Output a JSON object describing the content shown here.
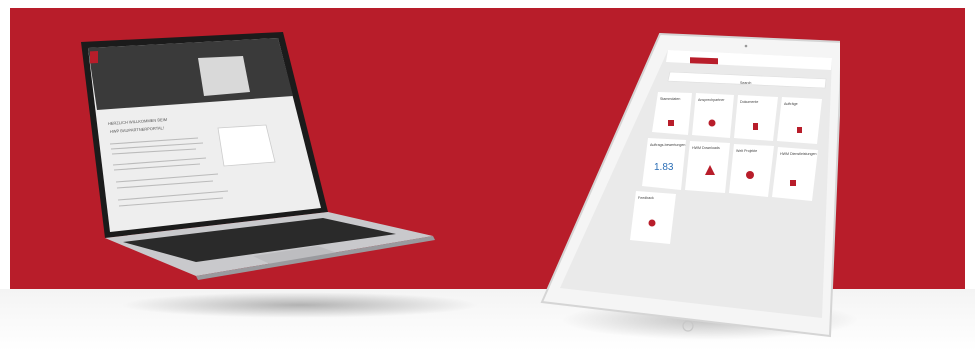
{
  "colors": {
    "brand_red": "#b81d2a",
    "screen_gray": "#3a3a3a",
    "tile_white": "#ffffff"
  },
  "laptop": {
    "screen_headline_1": "HERZLICH WILLKOMMEN BEIM",
    "screen_headline_2": "HWP BAUPARTNERPORTAL!"
  },
  "tablet": {
    "search_placeholder": "Search",
    "tiles": [
      "Stammdaten",
      "Ansprechpartner",
      "Dokumente",
      "Aufträge",
      "Auftrags-bewertungen",
      "HWM Downloads",
      "Welt Projekte",
      "HWM Dienstleistungen",
      "Feedback"
    ],
    "kpi_value": "1.83"
  }
}
